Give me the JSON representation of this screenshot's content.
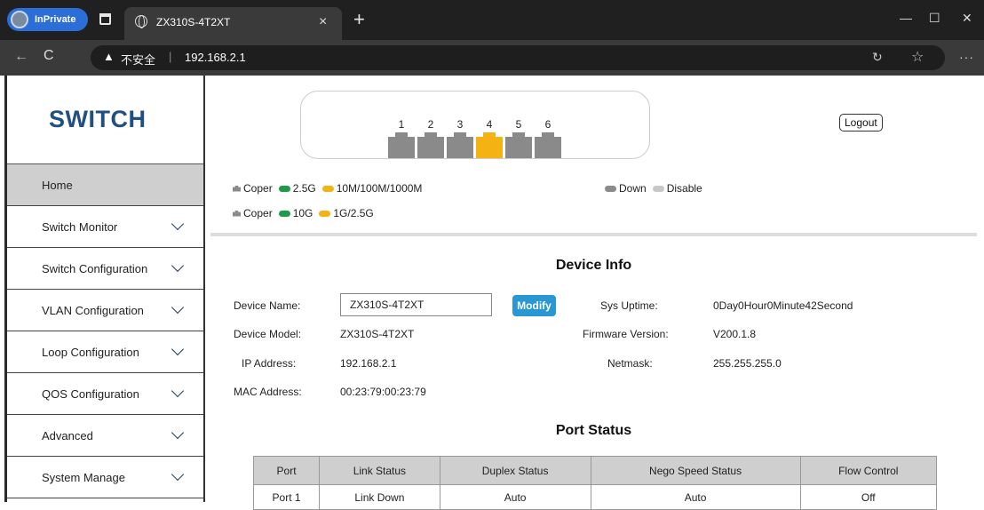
{
  "browser": {
    "inprivate_label": "InPrivate",
    "tab_title": "ZX310S-4T2XT",
    "tab_close": "×",
    "new_tab": "+",
    "window_controls": [
      "—",
      "☐",
      "✕"
    ],
    "nav_back": "←",
    "nav_reload": "C",
    "warning_glyph": "▲",
    "not_secure_label": "不安全",
    "separator": "|",
    "url": "192.168.2.1",
    "more": "···"
  },
  "sidebar": {
    "logo": "SWITCH",
    "items": [
      {
        "label": "Home",
        "active": true,
        "has_chevron": false
      },
      {
        "label": "Switch Monitor",
        "has_chevron": true
      },
      {
        "label": "Switch Configuration",
        "has_chevron": true
      },
      {
        "label": "VLAN Configuration",
        "has_chevron": true
      },
      {
        "label": "Loop Configuration",
        "has_chevron": true
      },
      {
        "label": "QOS Configuration",
        "has_chevron": true
      },
      {
        "label": "Advanced",
        "has_chevron": true
      },
      {
        "label": "System Manage",
        "has_chevron": true
      }
    ]
  },
  "panel": {
    "ports": [
      {
        "num": "1",
        "active": false
      },
      {
        "num": "2",
        "active": false
      },
      {
        "num": "3",
        "active": false
      },
      {
        "num": "4",
        "active": true
      },
      {
        "num": "5",
        "active": false
      },
      {
        "num": "6",
        "active": false
      }
    ],
    "logout_label": "Logout"
  },
  "legend": {
    "row1": {
      "coper": "Coper",
      "fast": "2.5G",
      "slow": "10M/100M/1000M"
    },
    "row2": {
      "coper": "Coper",
      "fast": "10G",
      "slow": "1G/2.5G"
    },
    "down": "Down",
    "disable": "Disable"
  },
  "colors": {
    "logo": "#1f4f83",
    "active_port": "#f5b213",
    "idle_port": "#8a8a8a",
    "green": "#1d9a4a",
    "yellow": "#f5b213",
    "down": "#8a8a8a",
    "disable": "#c8c8c8",
    "modify_button": "#2a97d5"
  },
  "device_info": {
    "title": "Device Info",
    "name_label": "Device Name:",
    "name_value": "ZX310S-4T2XT",
    "modify_label": "Modify",
    "model_label": "Device Model:",
    "model_value": "ZX310S-4T2XT",
    "ip_label": "IP Address:",
    "ip_value": "192.168.2.1",
    "mac_label": "MAC Address:",
    "mac_value": "00:23:79:00:23:79",
    "uptime_label": "Sys Uptime:",
    "uptime_value": "0Day0Hour0Minute42Second",
    "firmware_label": "Firmware Version:",
    "firmware_value": "V200.1.8",
    "netmask_label": "Netmask:",
    "netmask_value": "255.255.255.0"
  },
  "port_status": {
    "title": "Port Status",
    "headers": [
      "Port",
      "Link Status",
      "Duplex Status",
      "Nego Speed Status",
      "Flow Control"
    ],
    "rows": [
      [
        "Port 1",
        "Link Down",
        "Auto",
        "Auto",
        "Off"
      ]
    ]
  }
}
